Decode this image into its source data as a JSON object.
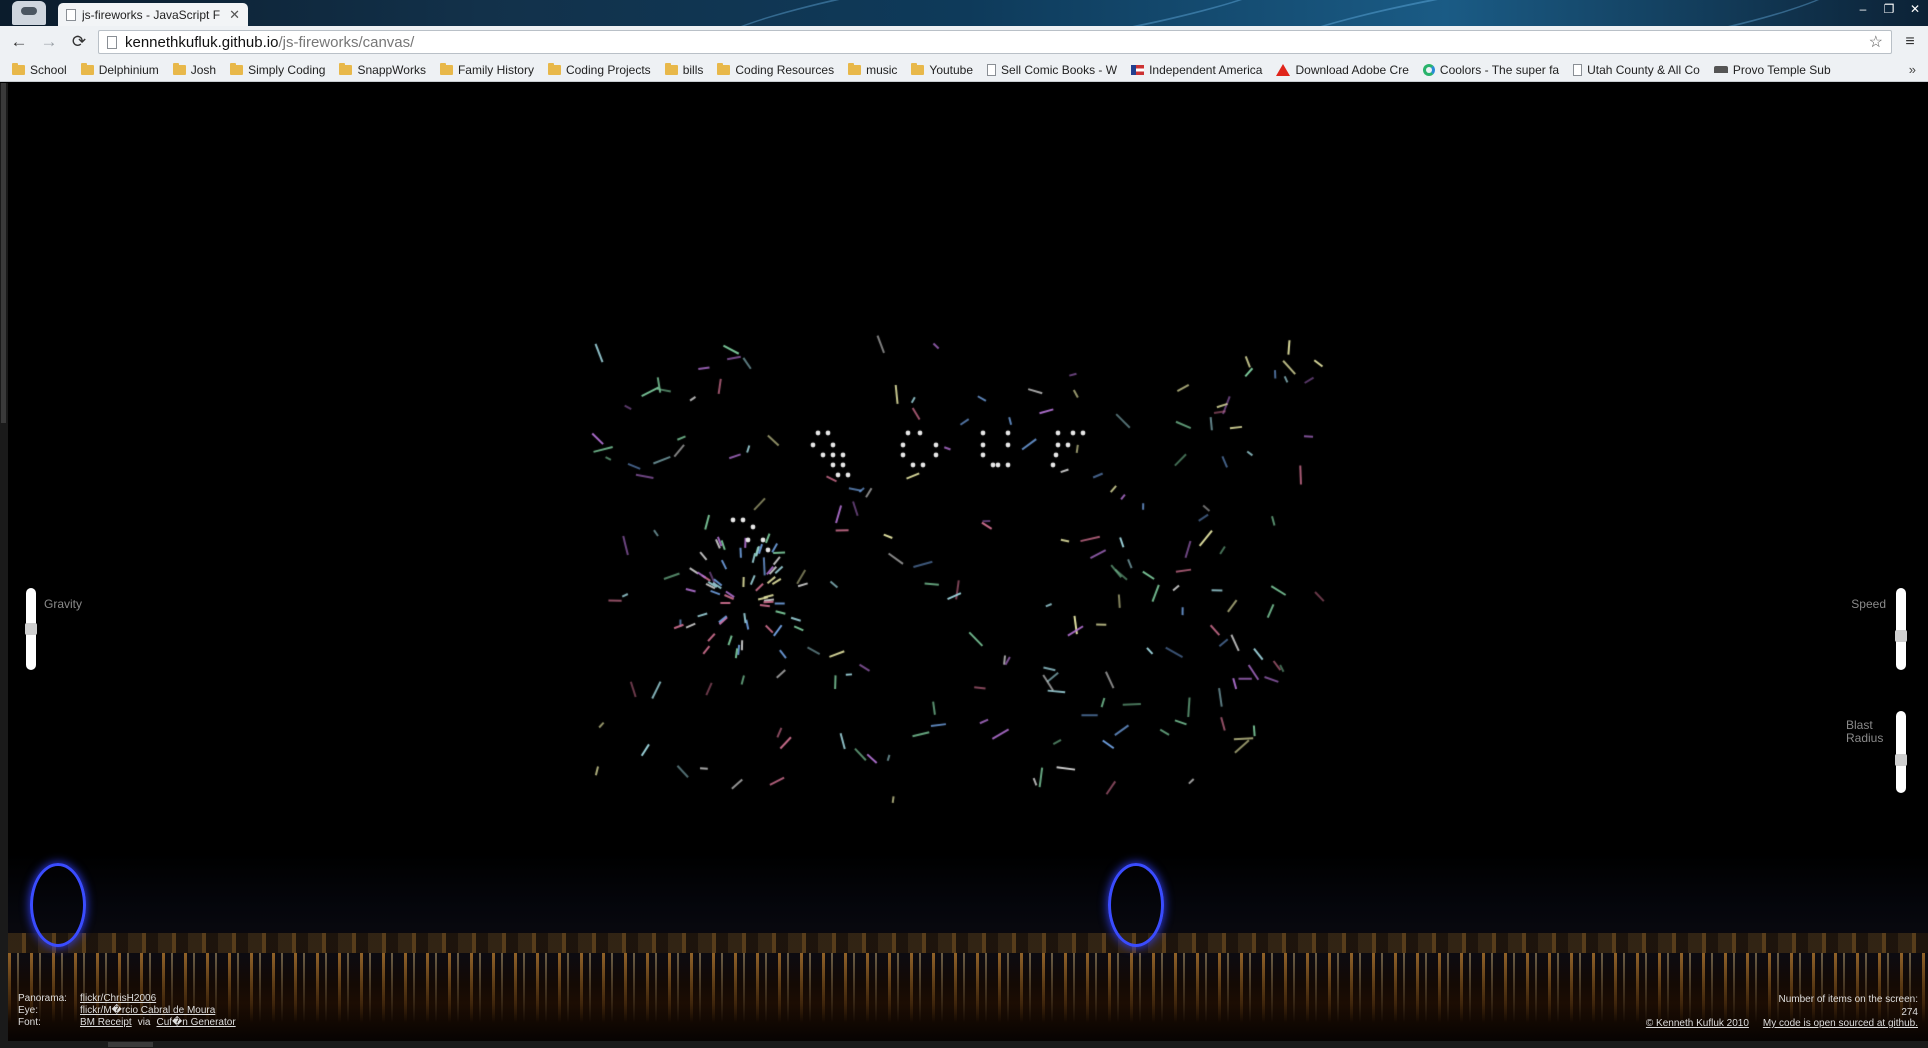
{
  "window": {
    "tab_title": "js-fireworks - JavaScript F",
    "tab_close": "✕",
    "controls": {
      "minimize": "–",
      "restore": "❐",
      "close": "✕"
    }
  },
  "toolbar": {
    "back": "←",
    "forward": "→",
    "reload": "⟳",
    "url_host": "kennethkufluk.github.io",
    "url_path": "/js-fireworks/canvas/",
    "star": "☆",
    "menu": "≡"
  },
  "bookmarks": {
    "items": [
      {
        "label": "School",
        "icon": "folder-icon"
      },
      {
        "label": "Delphinium",
        "icon": "folder-icon"
      },
      {
        "label": "Josh",
        "icon": "folder-icon"
      },
      {
        "label": "Simply Coding",
        "icon": "folder-icon"
      },
      {
        "label": "SnappWorks",
        "icon": "folder-icon"
      },
      {
        "label": "Family History",
        "icon": "folder-icon"
      },
      {
        "label": "Coding Projects",
        "icon": "folder-icon"
      },
      {
        "label": "bills",
        "icon": "folder-icon"
      },
      {
        "label": "Coding Resources",
        "icon": "folder-icon"
      },
      {
        "label": "music",
        "icon": "folder-icon"
      },
      {
        "label": "Youtube",
        "icon": "folder-icon"
      },
      {
        "label": "Sell Comic Books - W",
        "icon": "doc-icon"
      },
      {
        "label": "Independent America",
        "icon": "flag-icon"
      },
      {
        "label": "Download Adobe Cre",
        "icon": "adobe-icon"
      },
      {
        "label": "Coolors - The super fa",
        "icon": "coolors-icon"
      },
      {
        "label": "Utah County & All Co",
        "icon": "doc-icon"
      },
      {
        "label": "Provo Temple Sub",
        "icon": "provo-icon"
      }
    ],
    "more": "»"
  },
  "controls": {
    "gravity_label": "Gravity",
    "speed_label": "Speed",
    "blast_label": "Blast Radius",
    "gravity_value": 0.5,
    "speed_value": 0.6,
    "blast_value": 0.62
  },
  "credits": {
    "panorama_label": "Panorama:",
    "panorama_link": "flickr/ChrisH2006",
    "eye_label": "Eye:",
    "eye_link": "flickr/M�rcio Cabral de Moura",
    "font_label": "Font:",
    "font_link1": "BM Receipt",
    "font_via": "via",
    "font_link2": "Cuf�n Generator"
  },
  "counter": {
    "label": "Number of items on the screen:",
    "value": "274"
  },
  "footer": {
    "copyright": "© Kenneth Kufluk 2010",
    "github_link": "My code is open sourced at github."
  }
}
